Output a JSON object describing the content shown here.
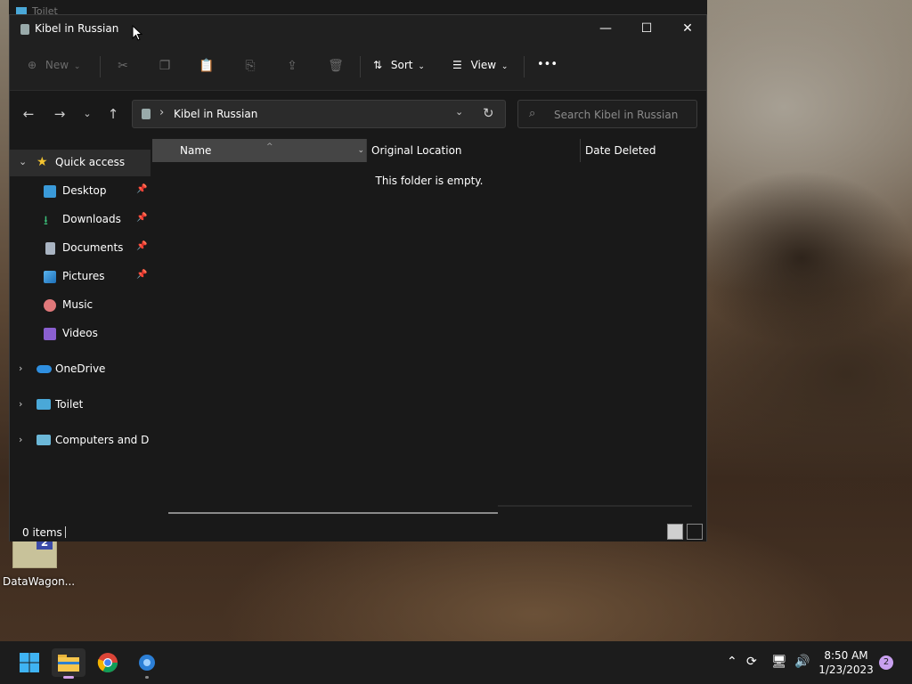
{
  "background_window": {
    "title": "Toilet"
  },
  "desktop_icon": {
    "label": "DataWagon..."
  },
  "window": {
    "title": "Kibel in Russian",
    "controls": {
      "minimize": "—",
      "maximize": "☐",
      "close": "✕"
    }
  },
  "toolbar": {
    "new_label": "New",
    "sort_label": "Sort",
    "view_label": "View",
    "more_label": "•••"
  },
  "address": {
    "path": "Kibel in Russian",
    "search_placeholder": "Search Kibel in Russian"
  },
  "sidebar": {
    "quick_access": "Quick access",
    "items": [
      {
        "label": "Desktop",
        "pinned": true
      },
      {
        "label": "Downloads",
        "pinned": true
      },
      {
        "label": "Documents",
        "pinned": true
      },
      {
        "label": "Pictures",
        "pinned": true
      },
      {
        "label": "Music",
        "pinned": false
      },
      {
        "label": "Videos",
        "pinned": false
      }
    ],
    "onedrive": "OneDrive",
    "toilet": "Toilet",
    "computers": "Computers and Dev"
  },
  "columns": {
    "name": "Name",
    "original_location": "Original Location",
    "date_deleted": "Date Deleted"
  },
  "empty_message": "This folder is empty.",
  "status": {
    "items": "0 items"
  },
  "taskbar": {
    "apps": [
      "Start",
      "File Explorer",
      "Google Chrome",
      "Devices app"
    ],
    "time": "8:50 AM",
    "date": "1/23/2023",
    "notification_count": "2"
  },
  "colors": {
    "accent_sidebar_selected": "#2d2d2d",
    "taskbar": "#1c1c1c",
    "window_bg": "#191919"
  }
}
